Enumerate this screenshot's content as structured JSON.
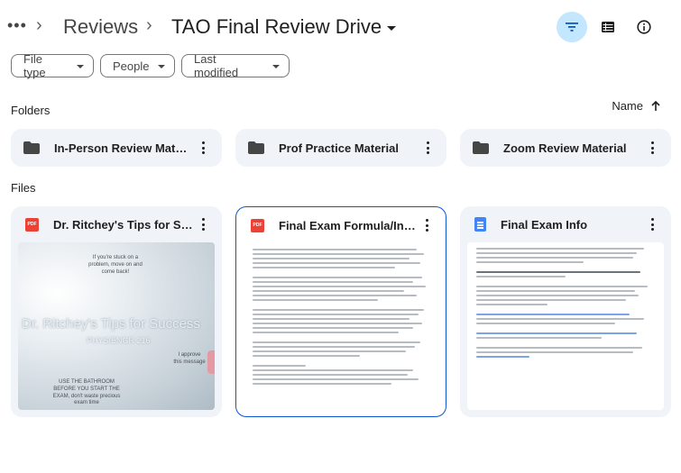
{
  "header": {
    "more": "•••",
    "breadcrumb": [
      {
        "label": "Reviews"
      }
    ],
    "current": "TAO Final Review Drive"
  },
  "toolbar": {
    "filter_icon": "filter-icon",
    "view_icon": "list-view-icon",
    "info_icon": "info-icon",
    "accent": "#c2e7ff"
  },
  "filters": [
    {
      "label": "File type"
    },
    {
      "label": "People"
    },
    {
      "label": "Last modified"
    }
  ],
  "folders_section": {
    "label": "Folders"
  },
  "sort": {
    "label": "Name",
    "direction": "ascending"
  },
  "folders": [
    {
      "name": "In-Person Review Material"
    },
    {
      "name": "Prof Practice Material"
    },
    {
      "name": "Zoom Review Material"
    }
  ],
  "files_section": {
    "label": "Files"
  },
  "files": [
    {
      "name": "Dr. Ritchey's Tips for Success",
      "type": "PDF",
      "thumb": {
        "title": "Dr. Ritchey's Tips for Success",
        "subtitle": "PHYS/ENGR 216",
        "note1": "If you're stuck on a problem, move on and come back!",
        "note2": "USE THE BATHROOM BEFORE YOU START THE EXAM, don't waste precious exam time",
        "note3": "I approve this message"
      }
    },
    {
      "name": "Final Exam Formula/Instructions",
      "type": "PDF"
    },
    {
      "name": "Final Exam Info",
      "type": "Docs"
    }
  ]
}
